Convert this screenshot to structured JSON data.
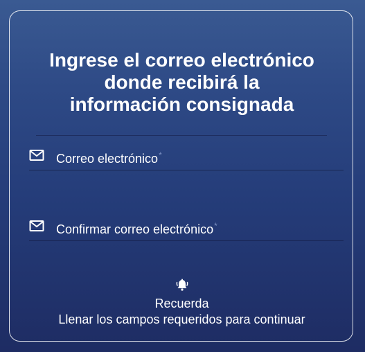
{
  "form": {
    "title_line1": "Ingrese el correo electrónico",
    "title_line2": "donde recibirá la",
    "title_line3": "información consignada",
    "email_field": {
      "label": "Correo electrónico",
      "required_mark": "*",
      "icon": "mail-icon"
    },
    "confirm_email_field": {
      "label": "Confirmar correo electrónico",
      "required_mark": "*",
      "icon": "mail-icon"
    },
    "reminder": {
      "icon": "bell-ring-icon",
      "title": "Recuerda",
      "text": "Llenar los campos requeridos para continuar"
    }
  },
  "colors": {
    "background_top": "#3a5a92",
    "background_bottom": "#1e2c63",
    "text": "#ffffff",
    "card_border": "#ffffff"
  }
}
